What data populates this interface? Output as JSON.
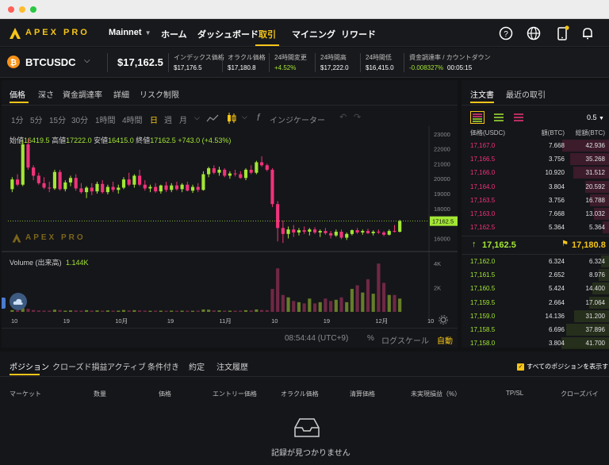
{
  "brand": {
    "name": "APEX PRO",
    "accent": "#f5c518"
  },
  "nav": {
    "network": "Mainnet",
    "items": [
      "ホーム",
      "ダッシュボード",
      "取引",
      "マイニング",
      "リワード"
    ],
    "active": "取引"
  },
  "ticker": {
    "symbol": "BTCUSDC",
    "price": "$17,162.5",
    "stats": [
      {
        "label": "インデックス価格",
        "value": "$17,176.5",
        "color": "#ffffff"
      },
      {
        "label": "オラクル価格",
        "value": "$17,180.8",
        "color": "#ffffff"
      },
      {
        "label": "24時間変更",
        "value": "+4.52%",
        "color": "#a3e635"
      },
      {
        "label": "24時間高",
        "value": "$17,222.0",
        "color": "#ffffff"
      },
      {
        "label": "24時間低",
        "value": "$16,415.0",
        "color": "#ffffff"
      },
      {
        "label": "資金調達率 / カウントダウン",
        "value": "-0.008327%",
        "value2": "00:05:15",
        "color": "#a3e635"
      }
    ]
  },
  "chart_tabs": [
    "価格",
    "深さ",
    "資金調達率",
    "詳細",
    "リスク制限"
  ],
  "chart_tab_active": "価格",
  "timeframes": [
    "1分",
    "5分",
    "15分",
    "30分",
    "1時間",
    "4時間",
    "日",
    "週",
    "月"
  ],
  "timeframe_active": "日",
  "indicator_label": "インジケーター",
  "ohlc": {
    "o_label": "始値",
    "o": "16419.5",
    "h_label": "高値",
    "h": "17222.0",
    "l_label": "安値",
    "l": "16415.0",
    "c_label": "終値",
    "c": "17162.5",
    "chg": "+743.0 (+4.53%)"
  },
  "volume": {
    "label": "Volume (出来高)",
    "value": "1.144K"
  },
  "footer": {
    "time": "08:54:44 (UTC+9)",
    "percent": "%",
    "log": "ログスケール",
    "auto": "自動"
  },
  "chart_data": {
    "type": "candlestick",
    "price_ticks": [
      23000,
      22000,
      21000,
      20000,
      19000,
      18000,
      17000,
      16000
    ],
    "current_price_label": "17162.5",
    "volume_ticks": [
      "4K",
      "2K"
    ],
    "x_ticks": [
      "10",
      "19",
      "10月",
      "19",
      "11月",
      "10",
      "19",
      "12月",
      "10"
    ],
    "ylim": [
      15600,
      23200
    ],
    "candles": [
      [
        19300,
        20100,
        19100,
        19950
      ],
      [
        19950,
        20300,
        19500,
        19600
      ],
      [
        19600,
        22600,
        19500,
        22300
      ],
      [
        22300,
        22700,
        20600,
        20750
      ],
      [
        20750,
        20900,
        19900,
        20200
      ],
      [
        20200,
        20400,
        19600,
        19700
      ],
      [
        19700,
        20100,
        19300,
        19400
      ],
      [
        19400,
        19800,
        19100,
        19350
      ],
      [
        19350,
        20600,
        19250,
        20450
      ],
      [
        20450,
        20600,
        19200,
        19300
      ],
      [
        19300,
        19900,
        19150,
        19750
      ],
      [
        19750,
        20200,
        19500,
        20050
      ],
      [
        20050,
        20300,
        19200,
        19350
      ],
      [
        19350,
        19700,
        19000,
        19100
      ],
      [
        19100,
        19500,
        18700,
        19400
      ],
      [
        19400,
        19700,
        18900,
        19150
      ],
      [
        19150,
        19800,
        19000,
        19650
      ],
      [
        19650,
        19900,
        19000,
        19100
      ],
      [
        19100,
        19600,
        18950,
        19450
      ],
      [
        19450,
        19800,
        19100,
        19250
      ],
      [
        19250,
        19600,
        19000,
        19400
      ],
      [
        19400,
        20100,
        19300,
        19950
      ],
      [
        19950,
        20400,
        19500,
        19600
      ],
      [
        19600,
        20300,
        19400,
        20200
      ],
      [
        20200,
        20600,
        19500,
        19600
      ],
      [
        19600,
        19900,
        19200,
        19350
      ],
      [
        19350,
        19600,
        19100,
        19450
      ],
      [
        19450,
        19700,
        19050,
        19150
      ],
      [
        19150,
        19600,
        19000,
        19550
      ],
      [
        19550,
        19800,
        19100,
        19250
      ],
      [
        19250,
        19700,
        19100,
        19550
      ],
      [
        19550,
        19800,
        19200,
        19300
      ],
      [
        19300,
        19700,
        19100,
        19600
      ],
      [
        19600,
        19800,
        19150,
        19200
      ],
      [
        19200,
        19600,
        19050,
        19450
      ],
      [
        19450,
        19700,
        19100,
        19250
      ],
      [
        19250,
        20500,
        19200,
        20300
      ],
      [
        20300,
        20800,
        20100,
        20700
      ],
      [
        20700,
        20900,
        20300,
        20400
      ],
      [
        20400,
        20800,
        20200,
        20600
      ],
      [
        20600,
        20700,
        20100,
        20200
      ],
      [
        20200,
        20500,
        20000,
        20350
      ],
      [
        20350,
        20600,
        20150,
        20300
      ],
      [
        20300,
        20500,
        20000,
        20050
      ],
      [
        20050,
        20700,
        19900,
        20600
      ],
      [
        20600,
        20900,
        20300,
        20400
      ],
      [
        20400,
        21200,
        20300,
        21100
      ],
      [
        21100,
        21500,
        20800,
        20900
      ],
      [
        20900,
        21000,
        20500,
        20600
      ],
      [
        20600,
        20700,
        18100,
        18300
      ],
      [
        18300,
        18500,
        15800,
        16700
      ],
      [
        16700,
        17200,
        15700,
        16300
      ],
      [
        16300,
        16800,
        16000,
        16600
      ],
      [
        16600,
        16900,
        16100,
        16400
      ],
      [
        16400,
        16700,
        16200,
        16550
      ],
      [
        16550,
        16800,
        16300,
        16450
      ],
      [
        16450,
        16700,
        16200,
        16600
      ],
      [
        16600,
        16750,
        16300,
        16400
      ],
      [
        16400,
        16600,
        16100,
        16500
      ],
      [
        16500,
        16700,
        16250,
        16350
      ],
      [
        16350,
        16500,
        16000,
        16200
      ],
      [
        16200,
        16600,
        16100,
        16450
      ],
      [
        16450,
        16600,
        15950,
        16050
      ],
      [
        16050,
        16400,
        15900,
        16300
      ],
      [
        16300,
        16600,
        16200,
        16550
      ],
      [
        16550,
        16700,
        16300,
        16400
      ],
      [
        16400,
        16600,
        16250,
        16500
      ],
      [
        16500,
        16650,
        16300,
        16350
      ],
      [
        16350,
        16550,
        16200,
        16450
      ],
      [
        16450,
        16600,
        16300,
        16400
      ],
      [
        16400,
        16500,
        16150,
        16250
      ],
      [
        16250,
        16600,
        16200,
        16500
      ],
      [
        16500,
        16900,
        16400,
        16450
      ],
      [
        16450,
        17250,
        16400,
        17160
      ]
    ],
    "volumes": [
      0.15,
      0.12,
      0.3,
      0.25,
      0.15,
      0.12,
      0.1,
      0.1,
      0.18,
      0.15,
      0.1,
      0.12,
      0.12,
      0.1,
      0.14,
      0.1,
      0.12,
      0.1,
      0.12,
      0.1,
      0.1,
      0.15,
      0.12,
      0.14,
      0.12,
      0.1,
      0.09,
      0.1,
      0.1,
      0.09,
      0.1,
      0.09,
      0.1,
      0.1,
      0.09,
      0.1,
      0.2,
      0.18,
      0.12,
      0.12,
      0.1,
      0.1,
      0.1,
      0.1,
      0.14,
      0.12,
      0.2,
      0.15,
      0.14,
      1.9,
      3.6,
      1.4,
      1.2,
      0.9,
      0.8,
      0.7,
      1.1,
      0.7,
      0.8,
      1.1,
      0.9,
      1.0,
      1.2,
      0.8,
      1.9,
      2.2,
      1.6,
      2.7,
      1.5,
      4.0,
      2.4,
      1.4,
      1.4,
      1.1
    ]
  },
  "orderbook": {
    "tabs": [
      "注文書",
      "最近の取引"
    ],
    "active": "注文書",
    "precision": "0.5",
    "headers": [
      "価格(USDC)",
      "額(BTC)",
      "総額(BTC)"
    ],
    "asks": [
      {
        "price": "17,167.0",
        "size": "7.668",
        "total": "42.936",
        "depth": 0.98
      },
      {
        "price": "17,166.5",
        "size": "3.756",
        "total": "35.268",
        "depth": 0.82
      },
      {
        "price": "17,166.0",
        "size": "10.920",
        "total": "31.512",
        "depth": 0.75
      },
      {
        "price": "17,164.0",
        "size": "3.804",
        "total": "20.592",
        "depth": 0.5
      },
      {
        "price": "17,163.5",
        "size": "3.756",
        "total": "16.788",
        "depth": 0.4
      },
      {
        "price": "17,163.0",
        "size": "7.668",
        "total": "13.032",
        "depth": 0.32
      },
      {
        "price": "17,162.5",
        "size": "5.364",
        "total": "5.364",
        "depth": 0.13
      }
    ],
    "last_price": "17,162.5",
    "oracle_price": "17,180.8",
    "bids": [
      {
        "price": "17,162.0",
        "size": "6.324",
        "total": "6.324",
        "depth": 0.16
      },
      {
        "price": "17,161.5",
        "size": "2.652",
        "total": "8.976",
        "depth": 0.22
      },
      {
        "price": "17,160.5",
        "size": "5.424",
        "total": "14.400",
        "depth": 0.35
      },
      {
        "price": "17,159.5",
        "size": "2.664",
        "total": "17.064",
        "depth": 0.41
      },
      {
        "price": "17,159.0",
        "size": "14.136",
        "total": "31.200",
        "depth": 0.74
      },
      {
        "price": "17,158.5",
        "size": "6.696",
        "total": "37.896",
        "depth": 0.9
      },
      {
        "price": "17,158.0",
        "size": "3.804",
        "total": "41.700",
        "depth": 1.0
      }
    ],
    "ask_color": "#f0337a",
    "bid_color": "#a3e635"
  },
  "bottom": {
    "tabs": [
      "ポジション",
      "クローズド損益",
      "アクティブ",
      "条件付き",
      "約定",
      "注文履歴"
    ],
    "active": "ポジション",
    "show_all": "すべてのポジションを表示する",
    "columns": [
      "マーケット",
      "数量",
      "価格",
      "エントリー価格",
      "オラクル価格",
      "清算価格",
      "未実現損益（%）",
      "TP/SL",
      "クローズバイ"
    ],
    "empty": "記録が見つかりません"
  }
}
